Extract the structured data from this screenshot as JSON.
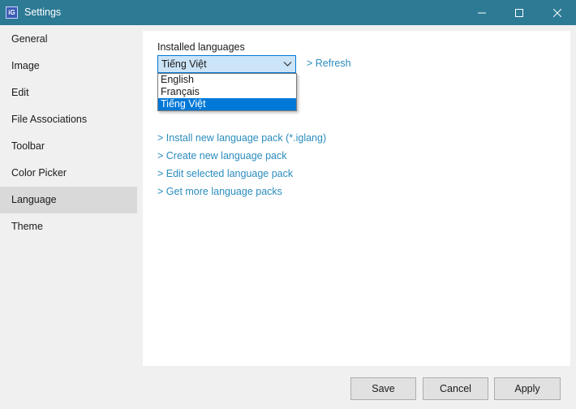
{
  "window": {
    "title": "Settings",
    "app_icon": "app-logo-icon",
    "controls": [
      "minimize-icon",
      "maximize-icon",
      "close-icon"
    ]
  },
  "sidebar": {
    "items": [
      {
        "label": "General"
      },
      {
        "label": "Image"
      },
      {
        "label": "Edit"
      },
      {
        "label": "File Associations"
      },
      {
        "label": "Toolbar"
      },
      {
        "label": "Color Picker"
      },
      {
        "label": "Language",
        "active": true
      },
      {
        "label": "Theme"
      }
    ]
  },
  "language": {
    "installed_label": "Installed languages",
    "selected": "Tiếng Việt",
    "refresh": "> Refresh",
    "options": [
      "English",
      "Français",
      "Tiếng Việt"
    ],
    "links": [
      "> Install new language pack (*.iglang)",
      "> Create new language pack",
      "> Edit selected language pack",
      "> Get more language packs"
    ]
  },
  "footer": {
    "save": "Save",
    "cancel": "Cancel",
    "apply": "Apply"
  },
  "colors": {
    "titlebar": "#2d7a95",
    "accent": "#0078d7",
    "link": "#2a8cbd",
    "sidebar_active": "#d9d9d9"
  }
}
